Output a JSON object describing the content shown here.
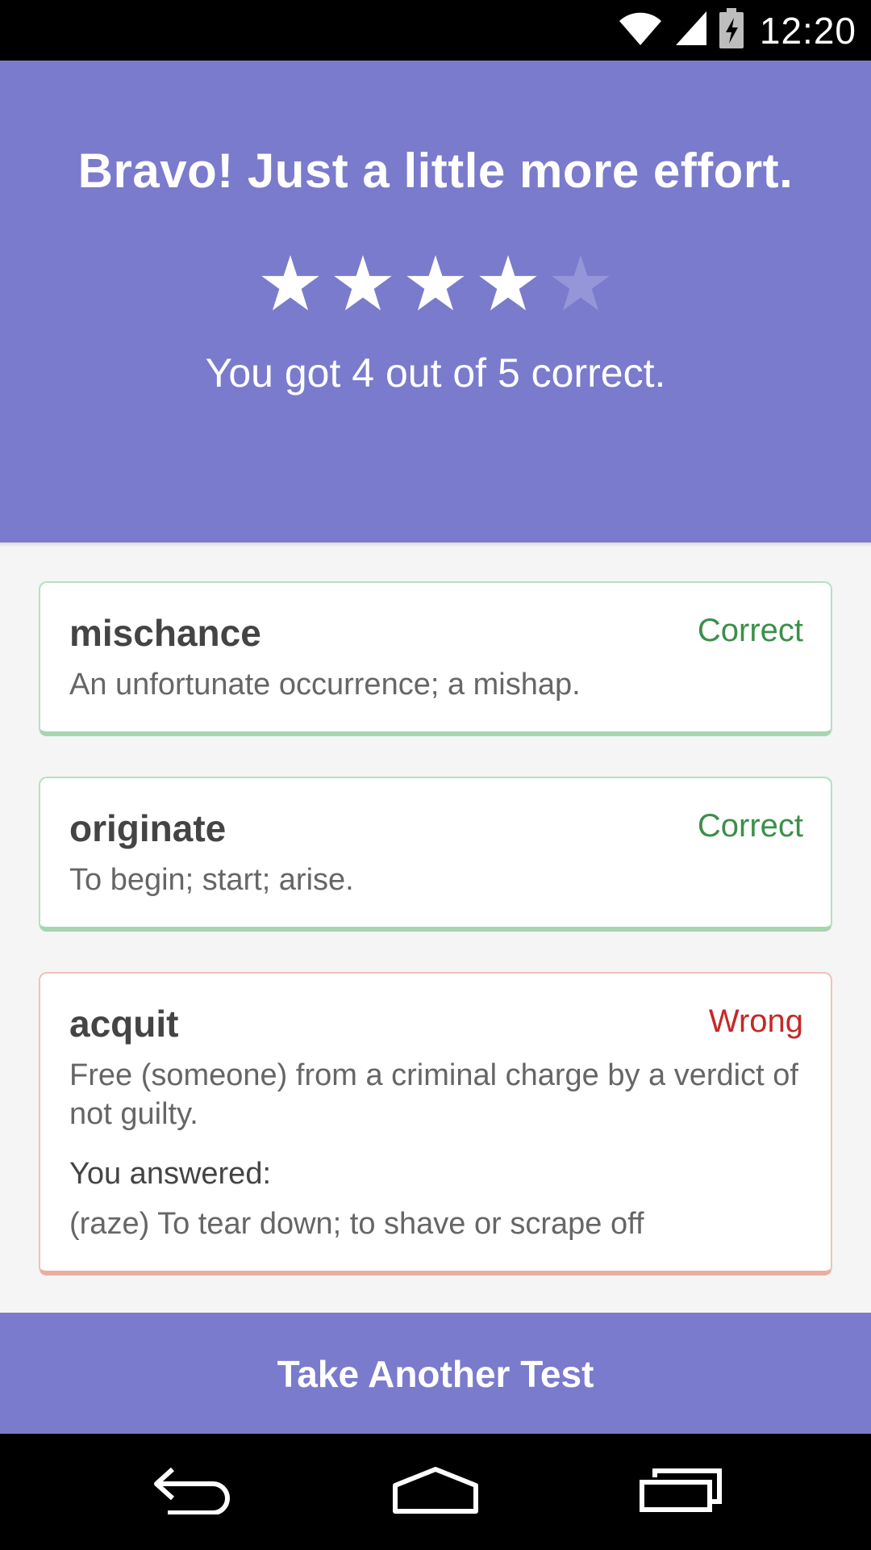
{
  "status_bar": {
    "time": "12:20",
    "icons": [
      "wifi-icon",
      "cell-signal-icon",
      "battery-charging-icon"
    ]
  },
  "header": {
    "headline": "Bravo! Just a little more effort.",
    "rating": {
      "filled": 4,
      "total": 5
    },
    "score_text": "You got 4 out of 5 correct."
  },
  "colors": {
    "accent": "#7a7bcc",
    "correct": "#3c8f4a",
    "wrong": "#c62828"
  },
  "results": [
    {
      "word": "mischance",
      "status": "Correct",
      "definition": "An unfortunate occurrence; a mishap."
    },
    {
      "word": "originate",
      "status": "Correct",
      "definition": "To begin; start; arise."
    },
    {
      "word": "acquit",
      "status": "Wrong",
      "definition": "Free (someone) from a criminal charge by a verdict of not guilty.",
      "answered_label": "You answered:",
      "answered": "(raze) To tear down; to shave or scrape off"
    }
  ],
  "action": {
    "label": "Take Another Test"
  },
  "nav_bar": {
    "icons": [
      "back-icon",
      "home-icon",
      "recent-apps-icon"
    ]
  }
}
